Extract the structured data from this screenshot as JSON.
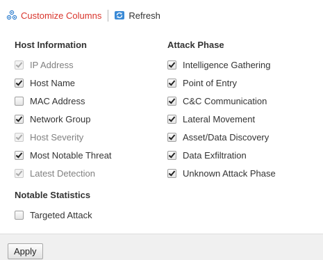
{
  "toolbar": {
    "customize_label": "Customize Columns",
    "customize_icon": "gear-cluster-icon",
    "refresh_label": "Refresh",
    "refresh_icon": "refresh-icon"
  },
  "groups": {
    "host_information": {
      "title": "Host Information",
      "items": [
        {
          "label": "IP Address",
          "checked": true,
          "disabled": true
        },
        {
          "label": "Host Name",
          "checked": true,
          "disabled": false
        },
        {
          "label": "MAC Address",
          "checked": false,
          "disabled": false
        },
        {
          "label": "Network Group",
          "checked": true,
          "disabled": false
        },
        {
          "label": "Host Severity",
          "checked": true,
          "disabled": true
        },
        {
          "label": "Most Notable Threat",
          "checked": true,
          "disabled": false
        },
        {
          "label": "Latest Detection",
          "checked": true,
          "disabled": true
        }
      ]
    },
    "attack_phase": {
      "title": "Attack Phase",
      "items": [
        {
          "label": "Intelligence Gathering",
          "checked": true,
          "disabled": false
        },
        {
          "label": "Point of Entry",
          "checked": true,
          "disabled": false
        },
        {
          "label": "C&C Communication",
          "checked": true,
          "disabled": false
        },
        {
          "label": "Lateral Movement",
          "checked": true,
          "disabled": false
        },
        {
          "label": "Asset/Data Discovery",
          "checked": true,
          "disabled": false
        },
        {
          "label": "Data Exfiltration",
          "checked": true,
          "disabled": false
        },
        {
          "label": "Unknown Attack Phase",
          "checked": true,
          "disabled": false
        }
      ]
    },
    "notable_statistics": {
      "title": "Notable Statistics",
      "items": [
        {
          "label": "Targeted Attack",
          "checked": false,
          "disabled": false
        }
      ]
    }
  },
  "footer": {
    "apply_label": "Apply"
  },
  "colors": {
    "customize_label": "#d9342b",
    "refresh_icon_blue": "#2f7fcf"
  }
}
